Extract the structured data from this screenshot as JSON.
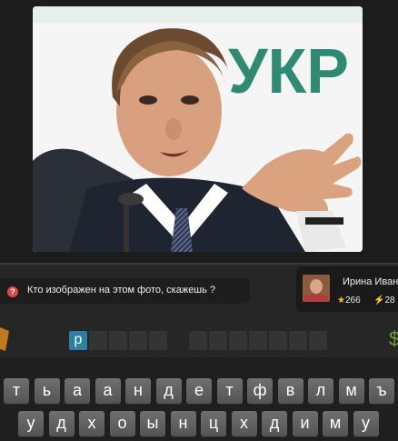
{
  "question": {
    "text": "Кто изображен на этом фото, скажешь ?",
    "icon": "question-icon"
  },
  "photo_sign_text": "УКР",
  "user": {
    "name": "Ирина Иванова",
    "stars": "266",
    "energy": "28"
  },
  "answer": {
    "revealed_letter": "р",
    "word1_empty_count": 4,
    "word2_empty_count": 7
  },
  "keyboard": {
    "row1": [
      "т",
      "ь",
      "а",
      "а",
      "н",
      "д",
      "е",
      "т",
      "ф",
      "в",
      "л",
      "м",
      "ъ"
    ],
    "row2": [
      "у",
      "д",
      "х",
      "о",
      "ы",
      "н",
      "ц",
      "х",
      "д",
      "и",
      "м",
      "у"
    ]
  },
  "colors": {
    "accent_slot": "#2d7fa3",
    "key": "#606060",
    "star": "#f5c518"
  }
}
